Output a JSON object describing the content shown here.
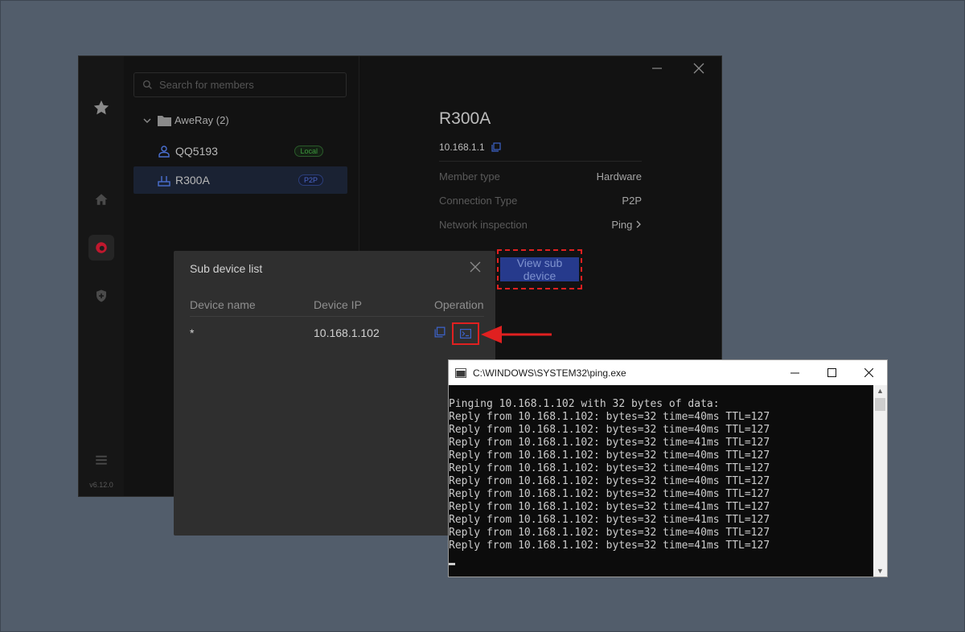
{
  "app": {
    "version": "v6.12.0",
    "search": {
      "placeholder": "Search for members"
    },
    "group": {
      "label": "AweRay (2)"
    },
    "members": [
      {
        "name": "QQ5193",
        "badge": "Local",
        "icon": "user-icon"
      },
      {
        "name": "R300A",
        "badge": "P2P",
        "icon": "router-icon",
        "selected": true
      }
    ],
    "detail": {
      "title": "R300A",
      "ip": "10.168.1.1",
      "props": [
        {
          "key": "Member type",
          "value": "Hardware"
        },
        {
          "key": "Connection Type",
          "value": "P2P"
        },
        {
          "key": "Network inspection",
          "value": "Ping"
        }
      ],
      "view_sub_device_label": "View sub device"
    }
  },
  "dialog": {
    "title": "Sub device list",
    "headers": {
      "name": "Device name",
      "ip": "Device IP",
      "op": "Operation"
    },
    "rows": [
      {
        "name": "*",
        "ip": "10.168.1.102"
      }
    ]
  },
  "console": {
    "title": "C:\\WINDOWS\\SYSTEM32\\ping.exe",
    "lines": [
      "Pinging 10.168.1.102 with 32 bytes of data:",
      "Reply from 10.168.1.102: bytes=32 time=40ms TTL=127",
      "Reply from 10.168.1.102: bytes=32 time=40ms TTL=127",
      "Reply from 10.168.1.102: bytes=32 time=41ms TTL=127",
      "Reply from 10.168.1.102: bytes=32 time=40ms TTL=127",
      "Reply from 10.168.1.102: bytes=32 time=40ms TTL=127",
      "Reply from 10.168.1.102: bytes=32 time=40ms TTL=127",
      "Reply from 10.168.1.102: bytes=32 time=40ms TTL=127",
      "Reply from 10.168.1.102: bytes=32 time=41ms TTL=127",
      "Reply from 10.168.1.102: bytes=32 time=41ms TTL=127",
      "Reply from 10.168.1.102: bytes=32 time=40ms TTL=127",
      "Reply from 10.168.1.102: bytes=32 time=41ms TTL=127"
    ]
  },
  "colors": {
    "accent": "#263a8c",
    "highlight": "#e02020",
    "p2p": "#4b67c9",
    "local": "#3d9a3d"
  }
}
